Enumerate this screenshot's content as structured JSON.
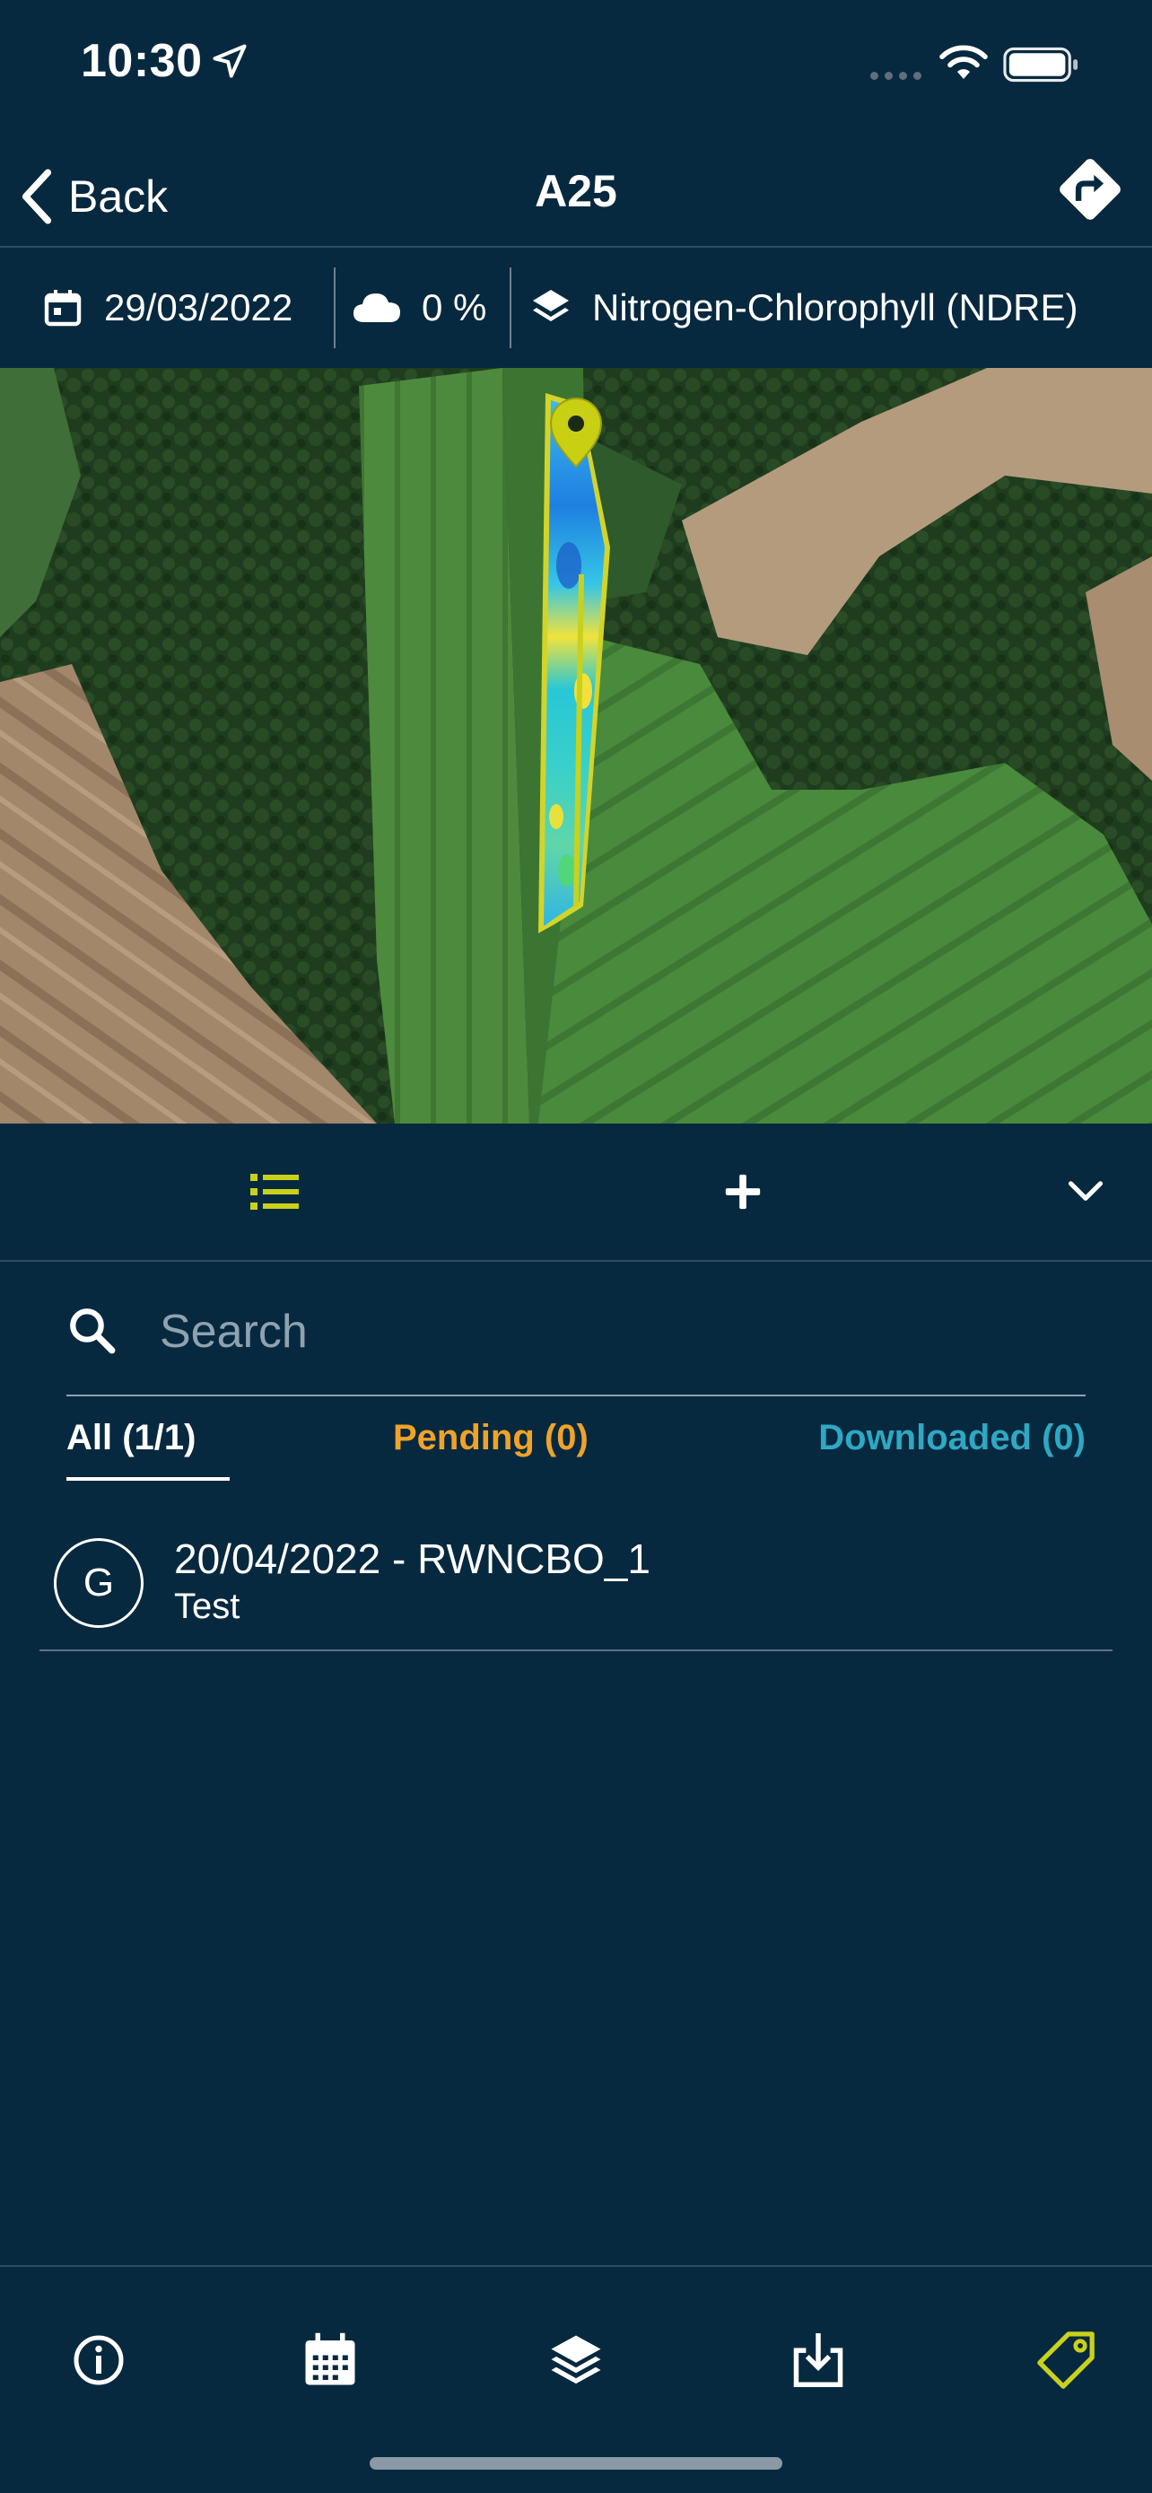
{
  "status_bar": {
    "time": "10:30"
  },
  "nav": {
    "back_label": "Back",
    "title": "A25"
  },
  "filters": {
    "date": "29/03/2022",
    "cloud_cover": "0 %",
    "layer": "Nitrogen-Chlorophyll (NDRE)"
  },
  "search": {
    "placeholder": "Search"
  },
  "tabs": {
    "all": "All (1/1)",
    "pending": "Pending (0)",
    "downloaded": "Downloaded (0)"
  },
  "list": {
    "items": [
      {
        "avatar": "G",
        "title": "20/04/2022 - RWNCBO_1",
        "subtitle": "Test"
      }
    ]
  },
  "colors": {
    "background": "#07293f",
    "accent": "#c9d11b",
    "pending": "#f0a229",
    "downloaded": "#2ea8c3"
  },
  "icons": {
    "status": [
      "location-arrow-icon",
      "signal-icon",
      "wifi-icon",
      "battery-icon"
    ],
    "nav": [
      "chevron-left-icon",
      "directions-icon"
    ],
    "filters": [
      "calendar-icon",
      "cloud-icon",
      "layers-icon"
    ],
    "toolbar": [
      "list-icon",
      "plus-icon",
      "chevron-down-icon"
    ],
    "bottom": [
      "info-icon",
      "calendar-grid-icon",
      "layers-icon",
      "download-icon",
      "tag-icon"
    ]
  }
}
